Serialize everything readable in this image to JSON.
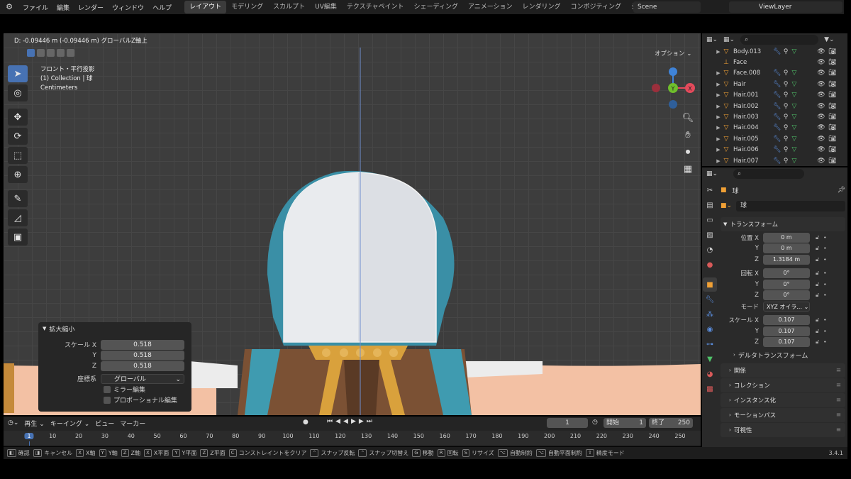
{
  "menu": {
    "items": [
      "ファイル",
      "編集",
      "レンダー",
      "ウィンドウ",
      "ヘルプ"
    ],
    "workspaces": [
      "レイアウト",
      "モデリング",
      "スカルプト",
      "UV編集",
      "テクスチャペイント",
      "シェーディング",
      "アニメーション",
      "レンダリング",
      "コンポジティング",
      "ジオメトリ"
    ],
    "scene": "Scene",
    "view_layer": "ViewLayer"
  },
  "viewport": {
    "header_text": "D: -0.09446 m (-0.09446 m) グローバルZ軸上",
    "view_name": "フロント・平行投影",
    "collection": "(1) Collection | 球",
    "units": "Centimeters",
    "options_label": "オプション"
  },
  "operator": {
    "title": "拡大縮小",
    "scale_label_x": "スケール X",
    "label_y": "Y",
    "label_z": "Z",
    "scale_x": "0.518",
    "scale_y": "0.518",
    "scale_z": "0.518",
    "orientation_label": "座標系",
    "orientation_value": "グローバル",
    "mirror_label": "ミラー編集",
    "proportional_label": "プロポーショナル編集"
  },
  "outliner": {
    "rows": [
      "Body.013",
      "Face",
      "Face.008",
      "Hair",
      "Hair.001",
      "Hair.002",
      "Hair.003",
      "Hair.004",
      "Hair.005",
      "Hair.006",
      "Hair.007"
    ]
  },
  "properties": {
    "object_name": "球",
    "object_name_field": "球",
    "transform_title": "トランスフォーム",
    "location_label": "位置 X",
    "rotation_label": "回転 X",
    "label_y": "Y",
    "label_z": "Z",
    "loc_x": "0 m",
    "loc_y": "0 m",
    "loc_z": "1.3184 m",
    "rot_x": "0°",
    "rot_y": "0°",
    "rot_z": "0°",
    "mode_label": "モード",
    "mode_value": "XYZ オイラ...",
    "scale_label": "スケール X",
    "scale_x": "0.107",
    "scale_y": "0.107",
    "scale_z": "0.107",
    "delta_label": "デルタトランスフォーム",
    "sections": [
      "関係",
      "コレクション",
      "インスタンス化",
      "モーションパス",
      "可視性"
    ]
  },
  "timeline": {
    "menu": [
      "再生",
      "キーイング",
      "ビュー",
      "マーカー"
    ],
    "current_frame": "1",
    "start_label": "開始",
    "start": "1",
    "end_label": "終了",
    "end": "250",
    "ticks": [
      "1",
      "10",
      "20",
      "30",
      "40",
      "50",
      "60",
      "70",
      "80",
      "90",
      "100",
      "110",
      "120",
      "130",
      "140",
      "150",
      "160",
      "170",
      "180",
      "190",
      "200",
      "210",
      "220",
      "230",
      "240",
      "250"
    ]
  },
  "status": {
    "items": [
      "確認",
      "キャンセル",
      "X軸",
      "Y軸",
      "Z軸",
      "X平面",
      "Y平面",
      "Z平面",
      "コンストレイントをクリア",
      "スナップ反転",
      "スナップ切替え",
      "移動",
      "回転",
      "リサイズ",
      "自動制約",
      "自動平面制約",
      "精度モード"
    ],
    "keys": [
      "X",
      "Y",
      "Z",
      "X",
      "Y",
      "Z",
      "C",
      "G",
      "R",
      "S"
    ],
    "version": "3.4.1"
  },
  "colors": {
    "accent": "#4772b3",
    "object_orange": "#f0a035",
    "viewport_bg": "#3d3d3d",
    "axis_x": "#e44a5b",
    "axis_y": "#6fbe2c",
    "axis_z": "#3f83d8"
  }
}
